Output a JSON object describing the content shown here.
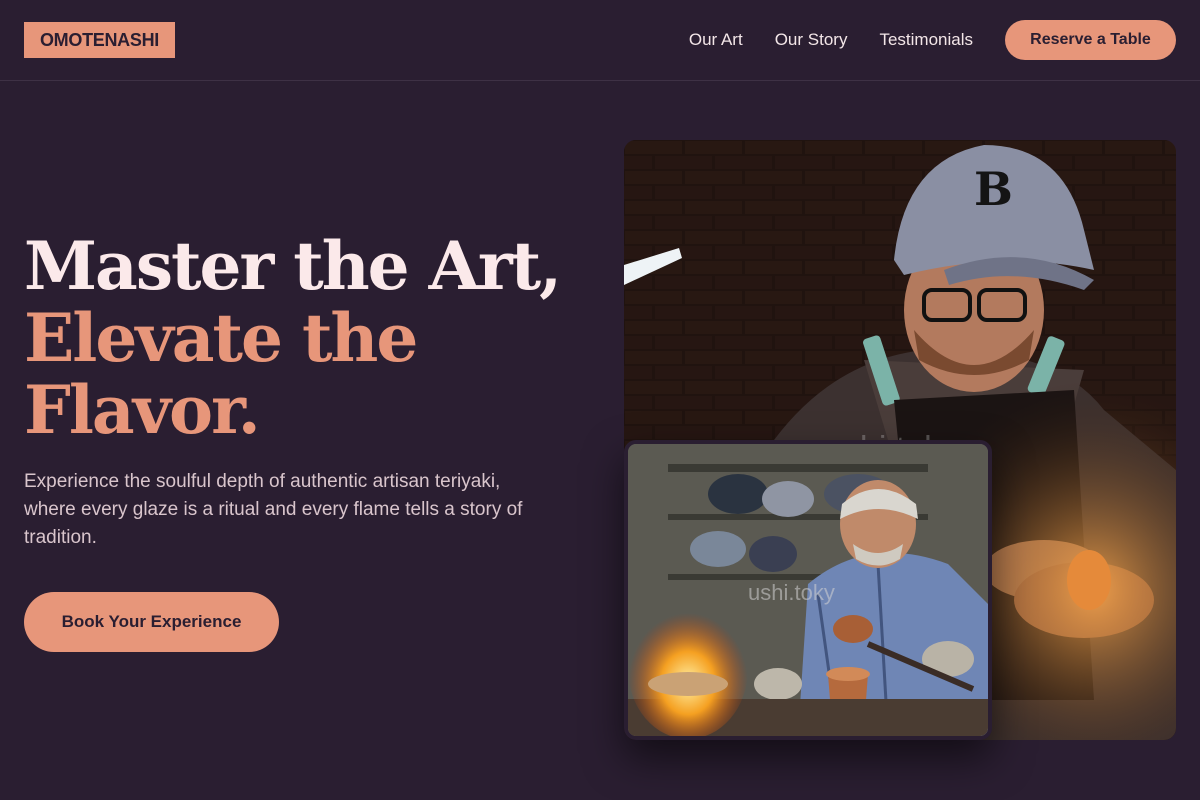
{
  "header": {
    "logo": "OMOTENASHI",
    "nav": [
      "Our Art",
      "Our Story",
      "Testimonials"
    ],
    "reserve_label": "Reserve a Table"
  },
  "hero": {
    "headline_line1": "Master the Art,",
    "headline_line2": "Elevate the",
    "headline_line3": "Flavor.",
    "lede": "Experience the soulful depth of authentic artisan teriyaki, where every glaze is a ritual and every flame tells a story of tradition.",
    "cta_label": "Book Your Experience"
  },
  "images": {
    "main_watermark": "ushi.toky",
    "inset_watermark": "ushi.toky"
  },
  "colors": {
    "background": "#2a1e31",
    "accent": "#e7967a",
    "headline_light": "#fbe9ea"
  }
}
